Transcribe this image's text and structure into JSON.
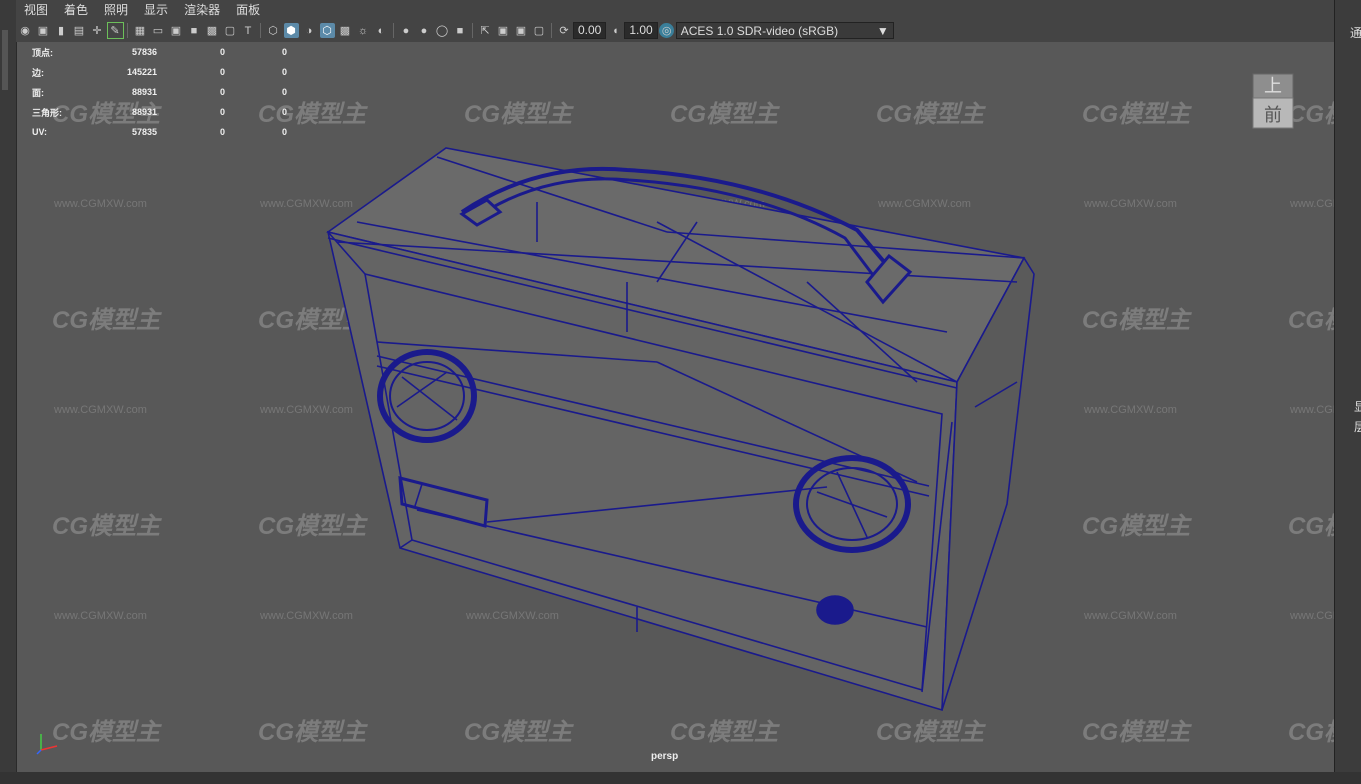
{
  "menu": [
    "视图",
    "着色",
    "照明",
    "显示",
    "渲染器",
    "面板"
  ],
  "toolbar": {
    "gamma_value": "0.00",
    "exposure_value": "1.00",
    "color_space": "ACES 1.0 SDR-video (sRGB)"
  },
  "hud": {
    "rows": [
      {
        "label": "顶点:",
        "v1": "57836",
        "v2": "0",
        "v3": "0"
      },
      {
        "label": "边:",
        "v1": "145221",
        "v2": "0",
        "v3": "0"
      },
      {
        "label": "面:",
        "v1": "88931",
        "v2": "0",
        "v3": "0"
      },
      {
        "label": "三角形:",
        "v1": "88931",
        "v2": "0",
        "v3": "0"
      },
      {
        "label": "UV:",
        "v1": "57835",
        "v2": "0",
        "v3": "0"
      }
    ]
  },
  "camera_label": "persp",
  "viewcube": {
    "top": "上",
    "front": "前"
  },
  "right_panel": {
    "t1": "通",
    "t2": "显",
    "t3": "层"
  },
  "watermark": {
    "logo": "CG模型主",
    "url": "www.CGMXW.com"
  },
  "colors": {
    "wire": "#1a1a8c",
    "viewport_bg": "#585858"
  }
}
